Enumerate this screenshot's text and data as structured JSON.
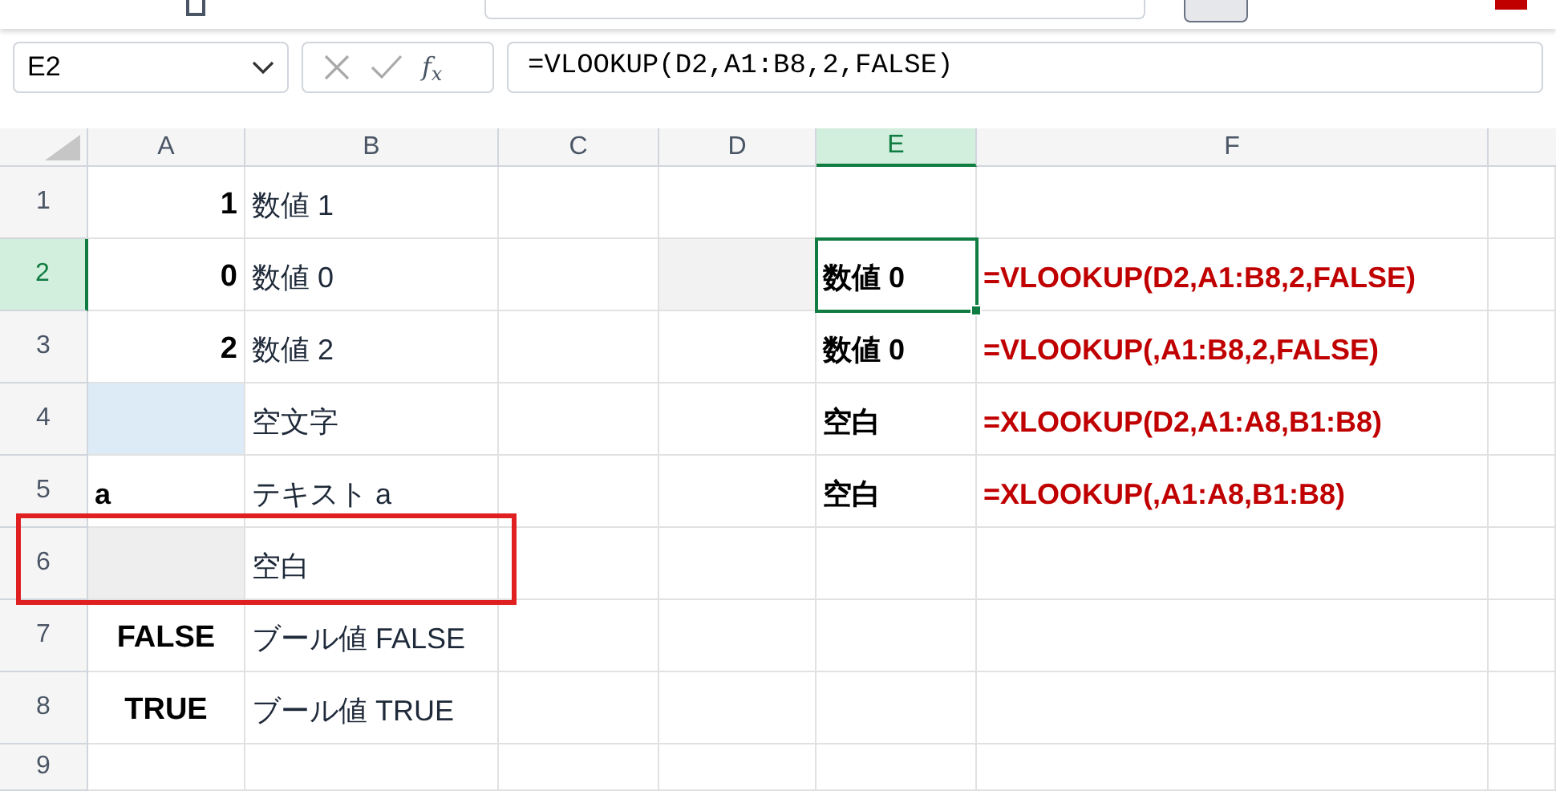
{
  "name_box": "E2",
  "function_label": "f$_{x}$",
  "formula": "=VLOOKUP(D2,A1:B8,2,FALSE)",
  "columns": [
    {
      "label": "A",
      "selected": false
    },
    {
      "label": "B",
      "selected": false
    },
    {
      "label": "C",
      "selected": false
    },
    {
      "label": "D",
      "selected": false
    },
    {
      "label": "E",
      "selected": true
    },
    {
      "label": "F",
      "selected": false
    }
  ],
  "rows": [
    {
      "header": "1",
      "selected": false,
      "framed": false,
      "cells": {
        "A": {
          "text": "1",
          "kind": "value"
        },
        "B": {
          "text": "数値 1",
          "kind": "label"
        }
      }
    },
    {
      "header": "2",
      "selected": true,
      "framed": false,
      "cells": {
        "A": {
          "text": "0",
          "kind": "value"
        },
        "B": {
          "text": "数値 0",
          "kind": "label"
        },
        "D": {
          "kind": "shaded",
          "color": "#f2f2f2"
        },
        "E": {
          "text": "数値 0",
          "kind": "result",
          "selected": true
        },
        "F": {
          "text": "=VLOOKUP(D2,A1:B8,2,FALSE)",
          "kind": "formula"
        }
      }
    },
    {
      "header": "3",
      "selected": false,
      "framed": false,
      "cells": {
        "A": {
          "text": "2",
          "kind": "value"
        },
        "B": {
          "text": "数値 2",
          "kind": "label"
        },
        "E": {
          "text": "数値 0",
          "kind": "result"
        },
        "F": {
          "text": "=VLOOKUP(,A1:B8,2,FALSE)",
          "kind": "formula"
        }
      }
    },
    {
      "header": "4",
      "selected": false,
      "framed": false,
      "cells": {
        "A": {
          "kind": "shaded",
          "color": "#ddebf7"
        },
        "B": {
          "text": "空文字",
          "kind": "label"
        },
        "E": {
          "text": "空白",
          "kind": "result"
        },
        "F": {
          "text": "=XLOOKUP(D2,A1:A8,B1:B8)",
          "kind": "formula"
        }
      }
    },
    {
      "header": "5",
      "selected": false,
      "framed": false,
      "cells": {
        "A": {
          "text": "a",
          "kind": "left"
        },
        "B": {
          "text": "テキスト a",
          "kind": "label"
        },
        "E": {
          "text": "空白",
          "kind": "result"
        },
        "F": {
          "text": "=XLOOKUP(,A1:A8,B1:B8)",
          "kind": "formula"
        }
      }
    },
    {
      "header": "6",
      "selected": false,
      "framed": true,
      "cells": {
        "A": {
          "kind": "shaded",
          "color": "#eeeeee"
        },
        "B": {
          "text": "空白",
          "kind": "label"
        }
      }
    },
    {
      "header": "7",
      "selected": false,
      "framed": false,
      "cells": {
        "A": {
          "text": "FALSE",
          "kind": "boolean"
        },
        "B": {
          "text": "ブール値 FALSE",
          "kind": "label"
        }
      }
    },
    {
      "header": "8",
      "selected": false,
      "framed": false,
      "cells": {
        "A": {
          "text": "TRUE",
          "kind": "boolean"
        },
        "B": {
          "text": "ブール値 TRUE",
          "kind": "label"
        }
      }
    },
    {
      "header": "9",
      "selected": false,
      "framed": false,
      "cells": {}
    }
  ]
}
